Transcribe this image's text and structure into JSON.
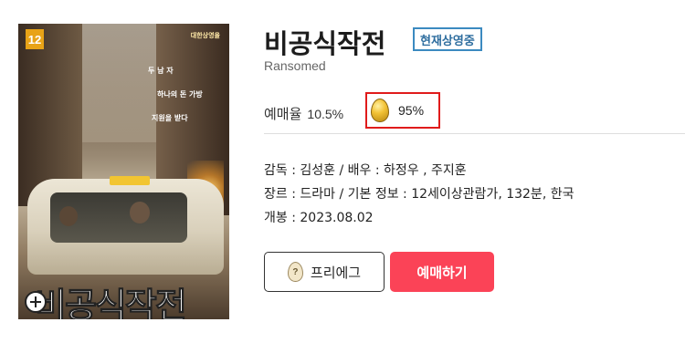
{
  "poster": {
    "age_rating": "12",
    "title_art": "비공식작전",
    "tagline_1": "두 남 자",
    "tagline_2": "하나의 돈 가방",
    "tagline_3": "지원을 받다",
    "top_text": "대한상영을"
  },
  "movie": {
    "title": "비공식작전",
    "status_badge": "현재상영중",
    "english_title": "Ransomed"
  },
  "stats": {
    "reservation_label": "예매율",
    "reservation_rate": "10.5%",
    "golden_egg_icon": "golden-egg-icon",
    "golden_egg_rate": "95%",
    "highlight_color": "#e01b1b"
  },
  "info": {
    "line1": "감독 : 김성훈 / 배우 : 하정우 ,  주지훈",
    "line2": "장르 : 드라마 / 기본 정보 : 12세이상관람가, 132분, 한국",
    "line3": "개봉 : 2023.08.02"
  },
  "actions": {
    "preegg_icon": "question-egg-icon",
    "preegg_icon_glyph": "?",
    "preegg_label": "프리에그",
    "reserve_label": "예매하기",
    "reserve_color": "#fb4357"
  }
}
